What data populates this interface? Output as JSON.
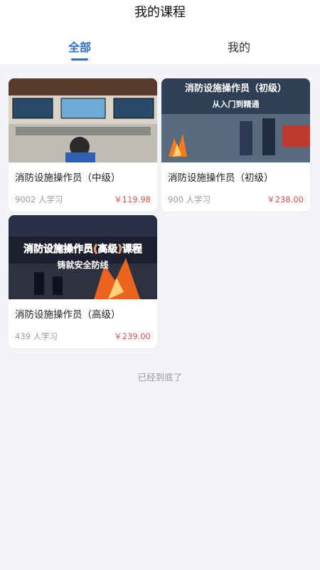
{
  "header": {
    "title": "我的课程"
  },
  "tabs": [
    {
      "label": "全部",
      "active": true
    },
    {
      "label": "我的",
      "active": false
    }
  ],
  "courses": [
    {
      "title": "消防设施操作员（中级）",
      "learners": "9002 人学习",
      "price": "￥119.98"
    },
    {
      "title": "消防设施操作员（初级）",
      "learners": "900 人学习",
      "price": "￥238.00",
      "banner": {
        "headline": "消防设施操作员（初级）",
        "subline": "从入门到精通"
      }
    },
    {
      "title": "消防设施操作员（高级）",
      "learners": "439 人学习",
      "price": "￥239.00",
      "banner": {
        "headline": "消防设施操作员(高级)课程",
        "subline": "铸就安全防线"
      }
    }
  ],
  "footer": {
    "end_text": "已经到底了"
  },
  "colors": {
    "accent": "#2f6fc8",
    "price": "#d9534f",
    "muted": "#9a9a9a",
    "background": "#f3f4f8"
  }
}
